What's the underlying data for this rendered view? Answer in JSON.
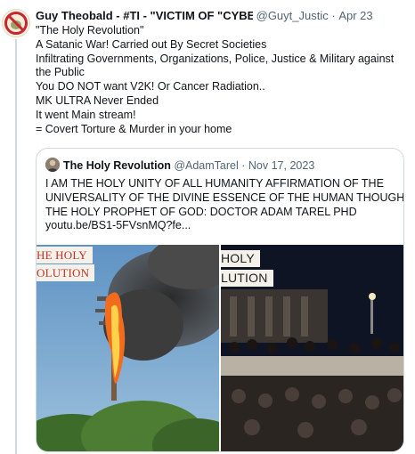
{
  "post": {
    "author_name": "Guy Theobald - #TI - \"VICTIM OF \"CYBER-TORTI",
    "handle": "@Guyt_Justic",
    "separator": "·",
    "date": "Apr 23",
    "lines": [
      "\"The Holy Revolution\"",
      "A Satanic War! Carried out By Secret Societies",
      "Infiltrating Governments, Organizations, Police, Justice & Military against",
      "the Public",
      "You DO NOT want V2K! Or Cancer Radiation..",
      "MK ULTRA Never Ended",
      "It  went Main stream!",
      "= Covert Torture & Murder in your home"
    ]
  },
  "quote": {
    "author_name": "The Holy Revolution",
    "handle": "@AdamTarel",
    "separator": "·",
    "date": "Nov 17, 2023",
    "lines": [
      "I AM THE HOLY UNITY OF ALL HUMANITY AFFIRMATION OF THE",
      "UNIVERSALITY OF THE DIVINE ESSENCE OF THE HUMAN THOUGHTS.",
      "THE HOLY PROPHET OF GOD: DOCTOR ADAM TAREL PHD"
    ],
    "link": "youtu.be/BS1-5FVsnMQ?fe...",
    "image_left_overlay": [
      "HE HOLY",
      "OLUTION"
    ],
    "image_right_overlay": [
      "HOLY",
      "LUTION"
    ]
  }
}
